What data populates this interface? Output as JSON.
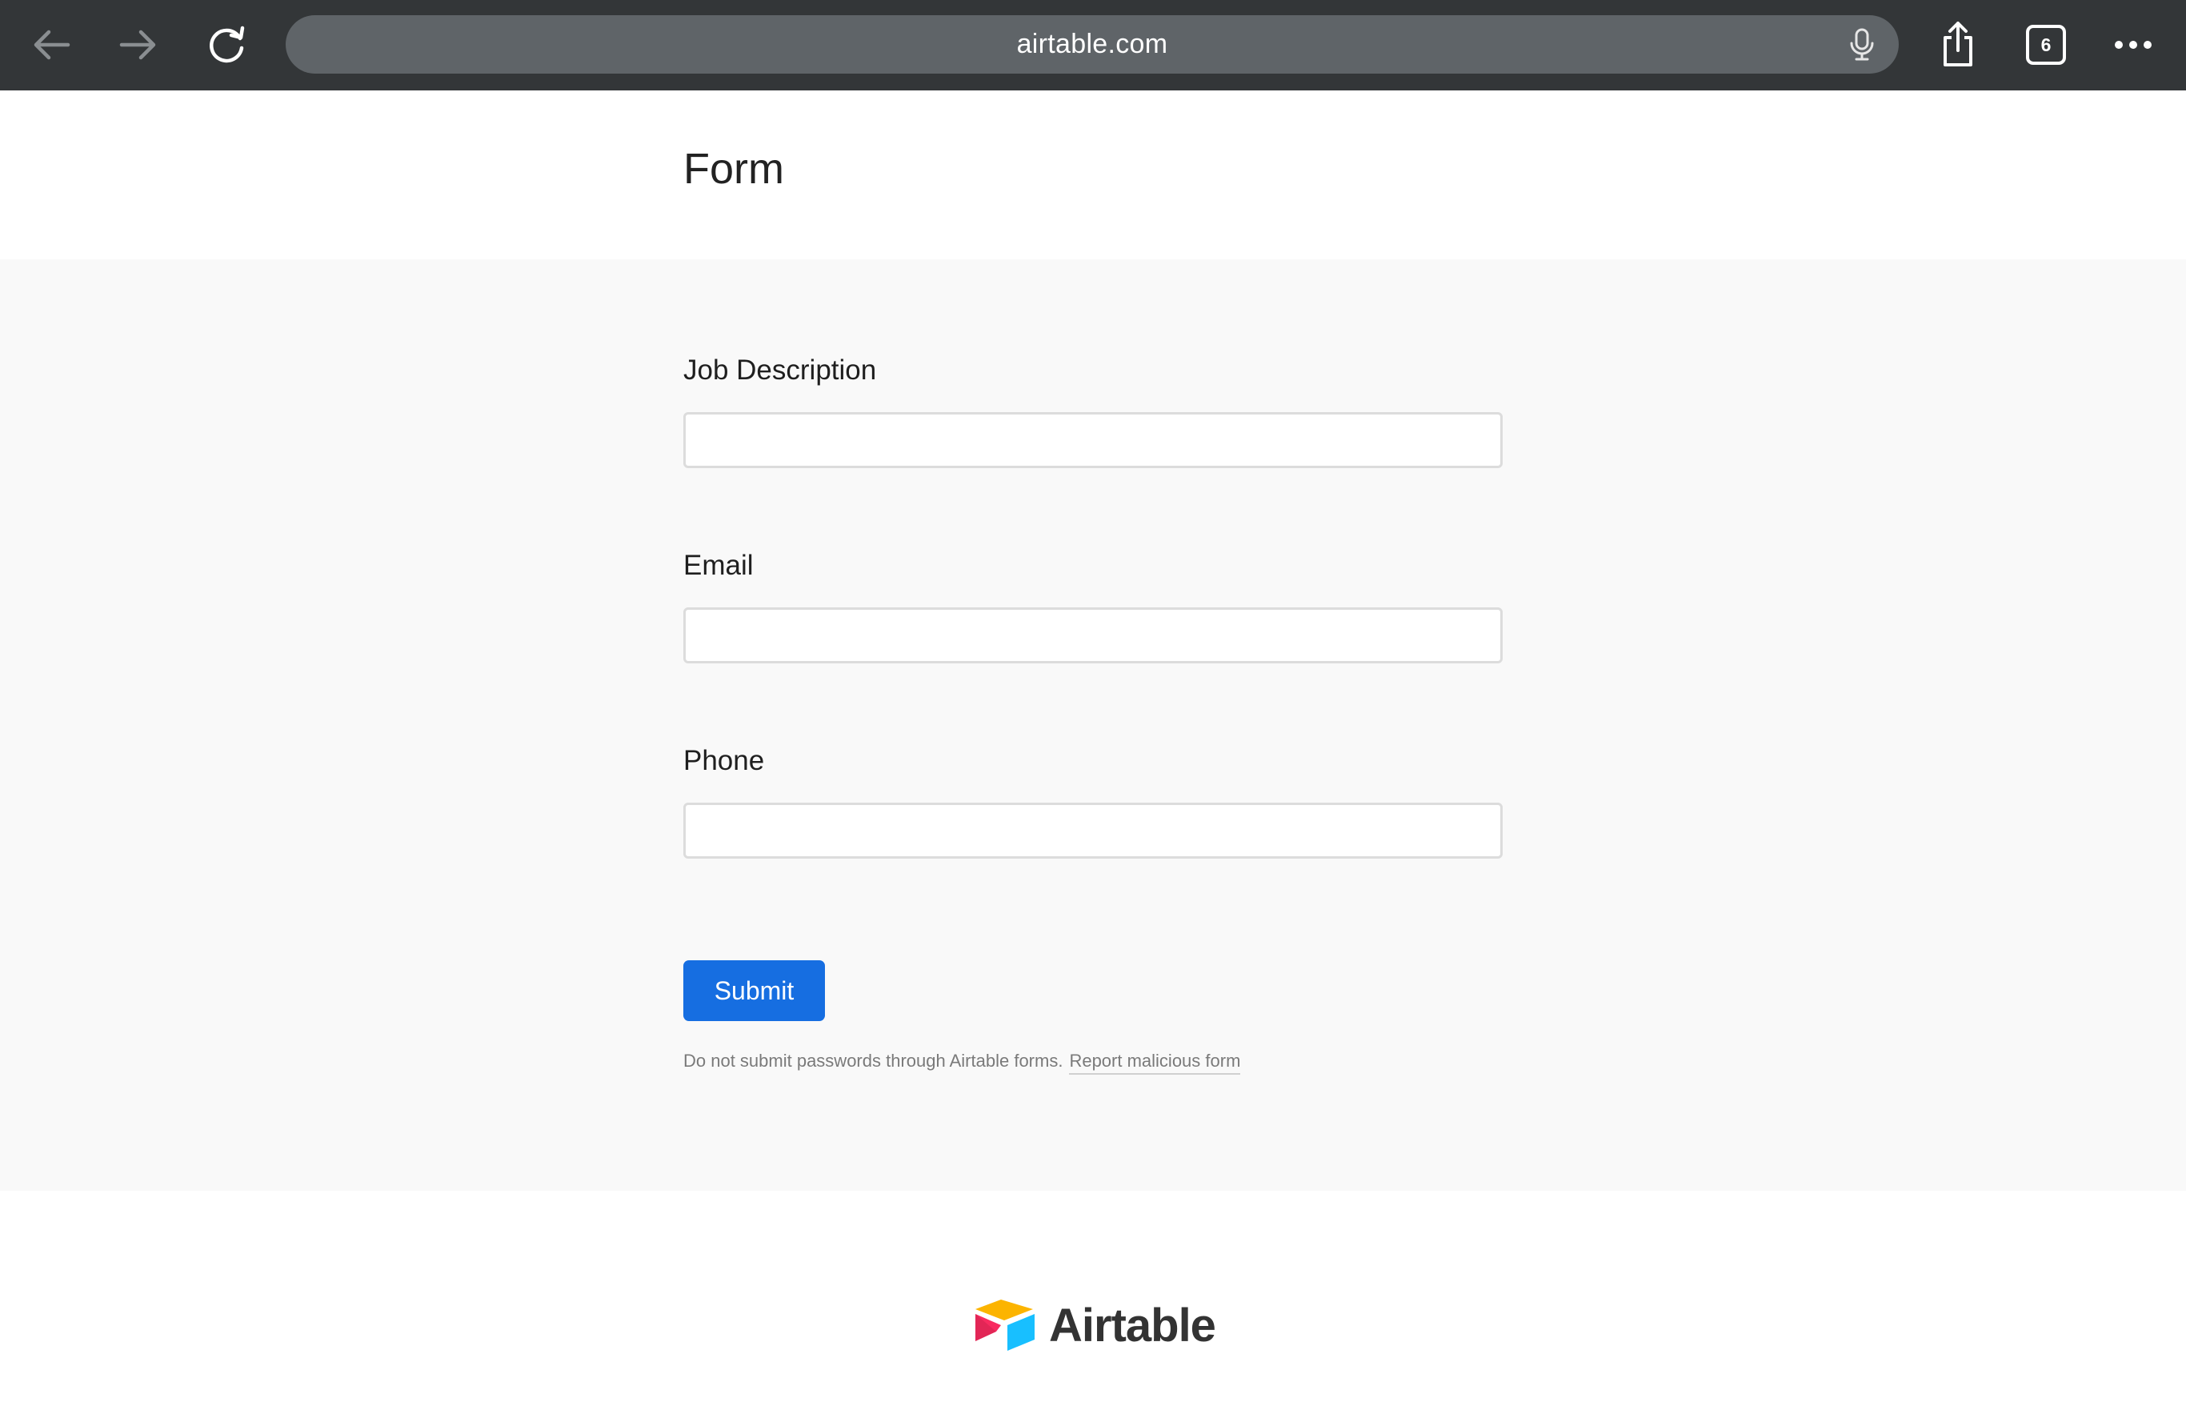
{
  "browser": {
    "url": "airtable.com",
    "tab_count": "6",
    "icons": {
      "back": "arrow-left-icon",
      "forward": "arrow-right-icon",
      "reload": "reload-icon",
      "mic": "microphone-icon",
      "share": "share-icon",
      "tabs": "tabs-icon",
      "more": "more-icon"
    }
  },
  "form": {
    "title": "Form",
    "fields": [
      {
        "label": "Job Description",
        "value": ""
      },
      {
        "label": "Email",
        "value": ""
      },
      {
        "label": "Phone",
        "value": ""
      }
    ],
    "submit_label": "Submit",
    "disclaimer": "Do not submit passwords through Airtable forms.",
    "report_link": "Report malicious form"
  },
  "footer": {
    "brand": "Airtable"
  },
  "colors": {
    "toolbar_bg": "#333638",
    "url_bar_bg": "#5f6468",
    "form_bg": "#f9f9f9",
    "submit_bg": "#166ee1"
  }
}
